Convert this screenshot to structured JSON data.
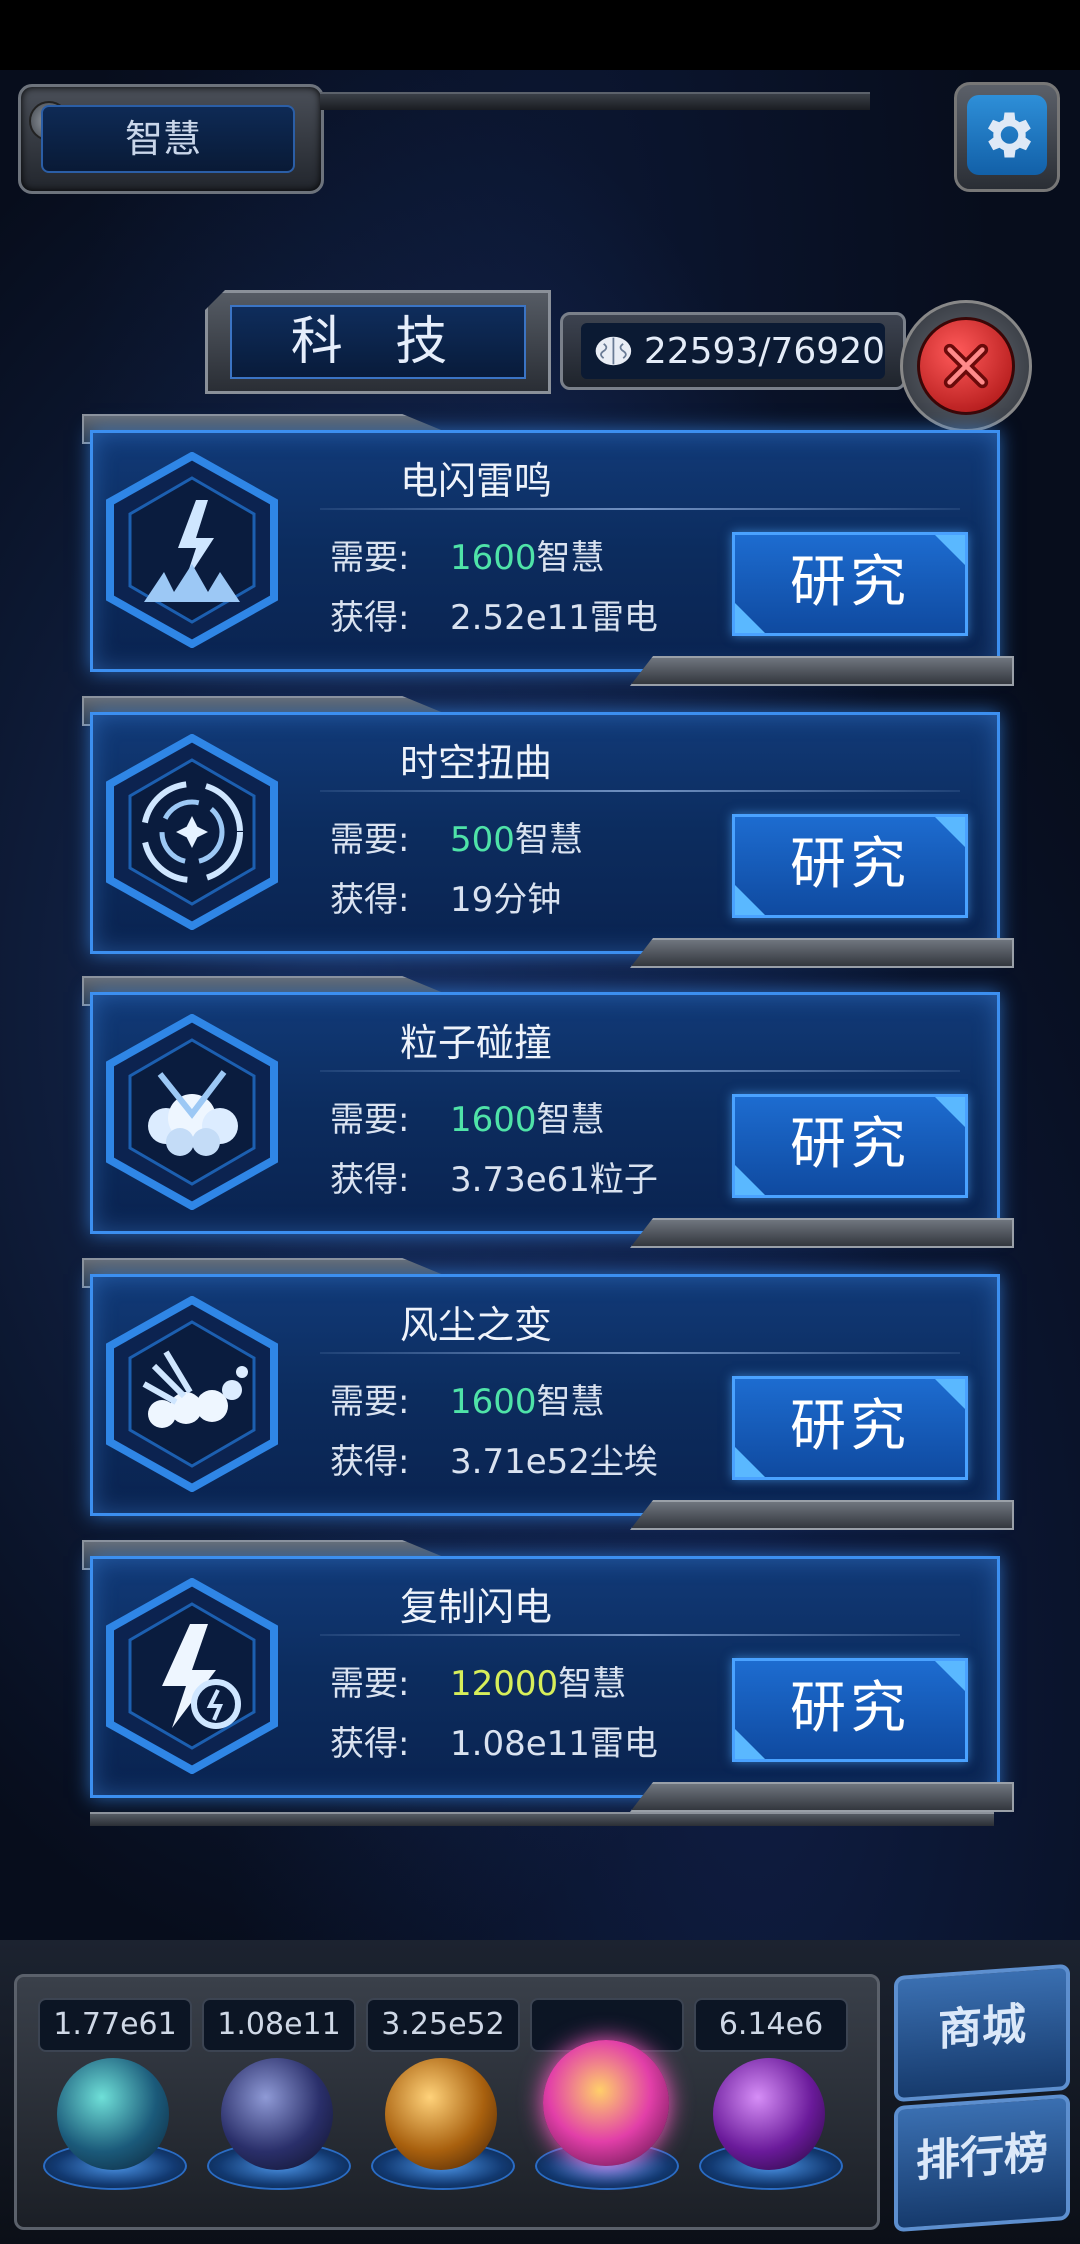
{
  "header": {
    "wisdom_tab_label": "智慧",
    "settings_icon": "gear-icon"
  },
  "panel": {
    "title": "科 技",
    "neuron_icon": "brain-icon",
    "neuron_count": "22593/76920",
    "close_icon": "close-icon"
  },
  "techs": [
    {
      "name": "电闪雷鸣",
      "icon": "lightning-strike-icon",
      "need_label": "需要:",
      "need_amount": "1600",
      "need_unit": "智慧",
      "gain_label": "获得:",
      "gain_value": "2.52e11雷电",
      "button": "研究"
    },
    {
      "name": "时空扭曲",
      "icon": "vortex-icon",
      "need_label": "需要:",
      "need_amount": "500",
      "need_unit": "智慧",
      "gain_label": "获得:",
      "gain_value": "19分钟",
      "button": "研究"
    },
    {
      "name": "粒子碰撞",
      "icon": "particle-collision-icon",
      "need_label": "需要:",
      "need_amount": "1600",
      "need_unit": "智慧",
      "gain_label": "获得:",
      "gain_value": "3.73e61粒子",
      "button": "研究"
    },
    {
      "name": "风尘之变",
      "icon": "dust-cloud-icon",
      "need_label": "需要:",
      "need_amount": "1600",
      "need_unit": "智慧",
      "gain_label": "获得:",
      "gain_value": "3.71e52尘埃",
      "button": "研究"
    },
    {
      "name": "复制闪电",
      "icon": "replicate-lightning-icon",
      "need_label": "需要:",
      "need_amount": "12000",
      "need_unit": "智慧",
      "gain_label": "获得:",
      "gain_value": "1.08e11雷电",
      "button": "研究"
    }
  ],
  "colors": {
    "affordable_amount": "#4fe3a8",
    "expensive_amount": "#d7ee5a",
    "button_blue": "#1d6cd0"
  },
  "dock": {
    "resources": [
      "1.77e61",
      "1.08e11",
      "3.25e52",
      "",
      "6.14e6"
    ],
    "orbs": [
      "particle-orb-icon",
      "lightning-orb-icon",
      "dust-orb-icon",
      "brain-orb-icon",
      "time-orb-icon"
    ],
    "shop_label": "商城",
    "rank_label": "排行榜"
  }
}
